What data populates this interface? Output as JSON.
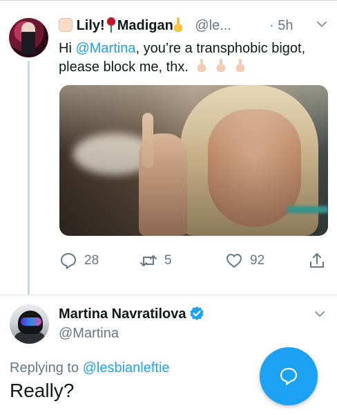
{
  "tweet1": {
    "display_name_part1": "Lily!",
    "display_name_part2": "Madigan",
    "handle": "@le...",
    "time": "· 5h",
    "text_prefix": "Hi ",
    "mention": "@Martina",
    "text_rest": ", you’re a transphobic bigot, please block me, thx.",
    "actions": {
      "reply_count": "28",
      "retweet_count": "5",
      "like_count": "92"
    }
  },
  "tweet2": {
    "display_name": "Martina Navratilova",
    "handle": "@Martina",
    "replying_prefix": "Replying to ",
    "replying_to": "@lesbianleftie",
    "text": "Really?"
  },
  "colors": {
    "accent": "#1da1f2",
    "secondary_text": "#657786",
    "primary_text": "#14171a"
  },
  "icons": [
    "chevron-down-icon",
    "reply-icon",
    "retweet-icon",
    "like-icon",
    "share-icon",
    "verified-badge-icon",
    "compose-reply-icon"
  ]
}
